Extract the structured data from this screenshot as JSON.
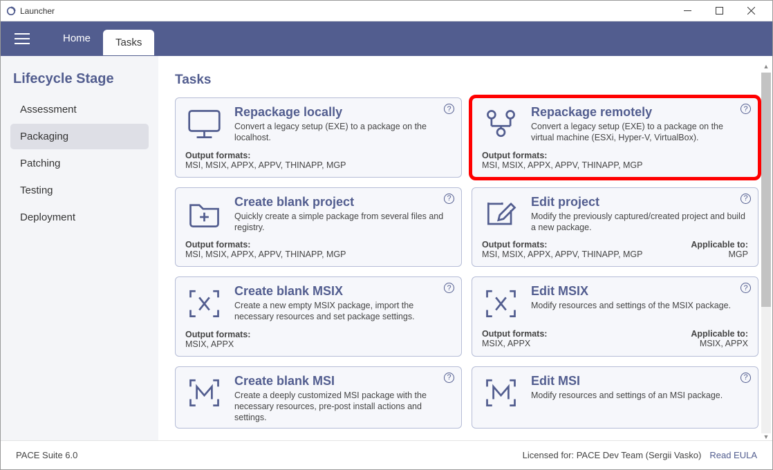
{
  "window": {
    "title": "Launcher"
  },
  "nav": {
    "tabs": [
      "Home",
      "Tasks"
    ],
    "active": 1
  },
  "sidebar": {
    "heading": "Lifecycle Stage",
    "items": [
      "Assessment",
      "Packaging",
      "Patching",
      "Testing",
      "Deployment"
    ],
    "active": 1
  },
  "main": {
    "heading": "Tasks",
    "output_formats_label": "Output formats:",
    "applicable_to_label": "Applicable to:",
    "cards": [
      {
        "title": "Repackage locally",
        "desc": "Convert a legacy setup (EXE) to a package on the localhost.",
        "formats": "MSI, MSIX, APPX, APPV, THINAPP, MGP",
        "applicable": "",
        "icon": "monitor"
      },
      {
        "title": "Repackage remotely",
        "desc": "Convert a legacy setup (EXE) to a package on the virtual machine (ESXi, Hyper-V, VirtualBox).",
        "formats": "MSI, MSIX, APPX, APPV, THINAPP, MGP",
        "applicable": "",
        "icon": "network",
        "highlight": true
      },
      {
        "title": "Create blank project",
        "desc": "Quickly create a simple package from several files and registry.",
        "formats": "MSI, MSIX, APPX, APPV, THINAPP, MGP",
        "applicable": "",
        "icon": "folder-plus"
      },
      {
        "title": "Edit project",
        "desc": "Modify the previously captured/created project and build a new package.",
        "formats": "MSI, MSIX, APPX, APPV, THINAPP, MGP",
        "applicable": "MGP",
        "icon": "edit"
      },
      {
        "title": "Create blank MSIX",
        "desc": "Create a new empty MSIX package, import the necessary resources and set package settings.",
        "formats": "MSIX, APPX",
        "applicable": "",
        "icon": "x-brackets"
      },
      {
        "title": "Edit MSIX",
        "desc": "Modify resources and settings of the MSIX package.",
        "formats": "MSIX, APPX",
        "applicable": "MSIX, APPX",
        "icon": "x-brackets"
      },
      {
        "title": "Create blank MSI",
        "desc": "Create a deeply customized MSI package with the necessary resources, pre-post install actions and settings.",
        "formats": "",
        "applicable": "",
        "icon": "m-brackets",
        "cut": true
      },
      {
        "title": "Edit MSI",
        "desc": "Modify resources and settings of an MSI package.",
        "formats": "",
        "applicable": "",
        "icon": "m-brackets",
        "cut": true
      }
    ]
  },
  "footer": {
    "version": "PACE Suite 6.0",
    "license": "Licensed for: PACE Dev Team (Sergii Vasko)",
    "eula": "Read EULA"
  }
}
